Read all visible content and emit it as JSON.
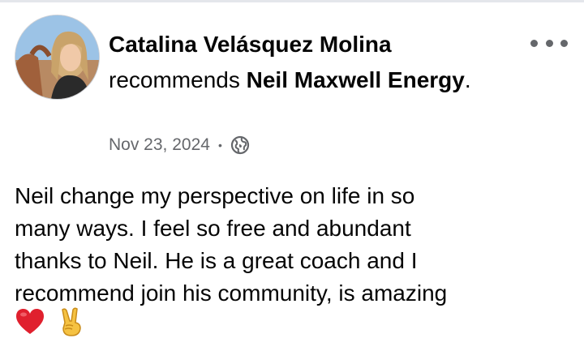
{
  "post": {
    "author": "Catalina Velásquez Molina",
    "action": "recommends",
    "page_name": "Neil Maxwell Energy",
    "trailing_period": ".",
    "date": "Nov 23, 2024",
    "separator": "•",
    "privacy_icon": "globe-icon",
    "more_icon": "more-options-icon",
    "body": "Neil change my perspective on life in so\nmany ways. I feel so free and abundant\nthanks to Neil. He is a great  coach and I\nrecommend join his community, is amazing",
    "emojis": [
      "heart-emoji",
      "victory-hand-emoji"
    ]
  },
  "colors": {
    "text": "#050505",
    "secondary_text": "#65676b",
    "heart": "#e0202e",
    "hand": "#f5c242"
  }
}
